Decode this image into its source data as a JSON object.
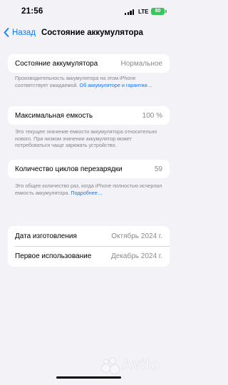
{
  "status_bar": {
    "time": "21:56",
    "network": "LTE",
    "battery_level": "80",
    "battery_color": "#34c759"
  },
  "nav": {
    "back_label": "Назад",
    "back_icon": "chevron-left-icon",
    "title": "Состояние аккумулятора",
    "accent_color": "#0a7aff"
  },
  "battery_health": {
    "label": "Состояние аккумулятора",
    "value": "Нормальное",
    "footer_text": "Производительность аккумулятора на этом iPhone соответствует ожидаемой. ",
    "footer_link": "Об аккумуляторе и гарантии…"
  },
  "max_capacity": {
    "label": "Максимальная емкость",
    "value": "100 %",
    "footer_text": "Это текущее значение емкости аккумулятора относительно нового. При низком значении аккумулятор может потребоваться чаще заряжать устройство."
  },
  "cycle_count": {
    "label": "Количество циклов перезарядки",
    "value": "59",
    "footer_text": "Это общее количество раз, когда iPhone полностью исчерпал емкость аккумулятора. ",
    "footer_link": "Подробнее…"
  },
  "dates": {
    "manufacture_label": "Дата изготовления",
    "manufacture_value": "Октябрь 2024 г.",
    "first_use_label": "Первое использование",
    "first_use_value": "Декабрь 2024 г."
  },
  "watermark": {
    "text": "Avito"
  }
}
